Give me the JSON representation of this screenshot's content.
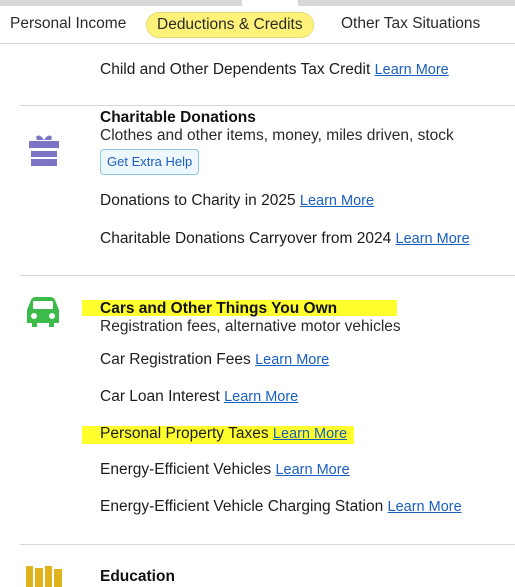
{
  "tabs": {
    "personal_income": "Personal Income",
    "deductions_credits": "Deductions & Credits",
    "other_situations": "Other Tax Situations"
  },
  "child_dependents": {
    "label": "Child and Other Dependents Tax Credit",
    "link": "Learn More"
  },
  "charitable": {
    "title": "Charitable Donations",
    "subtitle": "Clothes and other items, money, miles driven, stock",
    "help_button": "Get Extra Help",
    "items": [
      {
        "label": "Donations to Charity in 2025",
        "link": "Learn More"
      },
      {
        "label": "Charitable Donations Carryover from 2024",
        "link": "Learn More"
      }
    ]
  },
  "cars": {
    "title": "Cars and Other Things You Own",
    "subtitle": "Registration fees, alternative motor vehicles",
    "items": [
      {
        "label": "Car Registration Fees",
        "link": "Learn More"
      },
      {
        "label": "Car Loan Interest",
        "link": "Learn More"
      },
      {
        "label": "Personal Property Taxes",
        "link": "Learn More"
      },
      {
        "label": "Energy-Efficient Vehicles",
        "link": "Learn More"
      },
      {
        "label": "Energy-Efficient Vehicle Charging Station",
        "link": "Learn More"
      }
    ]
  },
  "education": {
    "title": "Education"
  },
  "colors": {
    "highlight": "#ffff2e",
    "link": "#1a5fc0",
    "gift_icon": "#7b74c4",
    "car_icon": "#3dbb4a",
    "education_icon": "#e0b21c"
  },
  "icons": {
    "charitable": "gift-icon",
    "cars": "car-icon",
    "education": "books-icon"
  }
}
